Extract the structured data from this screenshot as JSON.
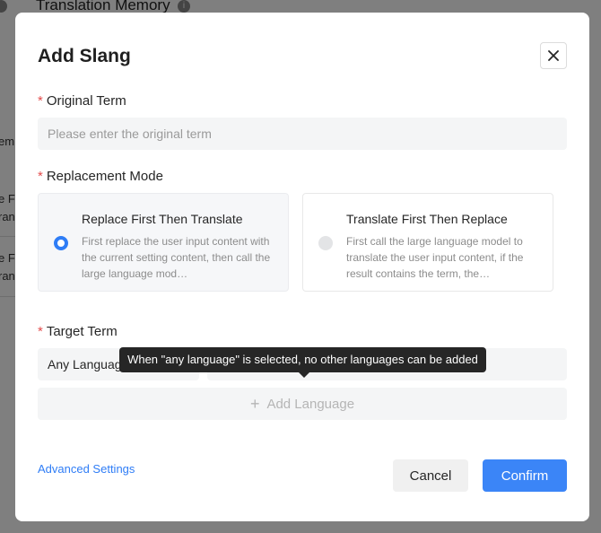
{
  "background": {
    "page_title": "Translation Memory",
    "fragments": [
      "em",
      "e F",
      "ran",
      "e F",
      "ran"
    ]
  },
  "modal": {
    "title": "Add Slang",
    "close_label": "×",
    "original_term": {
      "label": "Original Term",
      "required_mark": "*",
      "placeholder": "Please enter the original term",
      "value": ""
    },
    "replacement_mode": {
      "label": "Replacement Mode",
      "required_mark": "*",
      "options": [
        {
          "title": "Replace First Then Translate",
          "description": "First replace the user input content with the current setting content, then call the large language mod…",
          "selected": true
        },
        {
          "title": "Translate First Then Replace",
          "description": "First call the large language model to translate the user input content, if the result contains the term, the…",
          "selected": false
        }
      ]
    },
    "target_term": {
      "label": "Target Term",
      "required_mark": "*",
      "language_value": "Any Language",
      "term_value": "",
      "add_language_label": "Add Language",
      "tooltip": "When \"any language\" is selected, no other languages can be added"
    },
    "advanced_settings_label": "Advanced Settings",
    "cancel_label": "Cancel",
    "confirm_label": "Confirm"
  },
  "colors": {
    "accent": "#2f7df6",
    "confirm_bg": "#3b85f7",
    "required": "#e34d4d",
    "tooltip_bg": "#262626"
  },
  "icons": {
    "close": "close-icon",
    "plus": "plus-icon",
    "info": "info-icon"
  }
}
